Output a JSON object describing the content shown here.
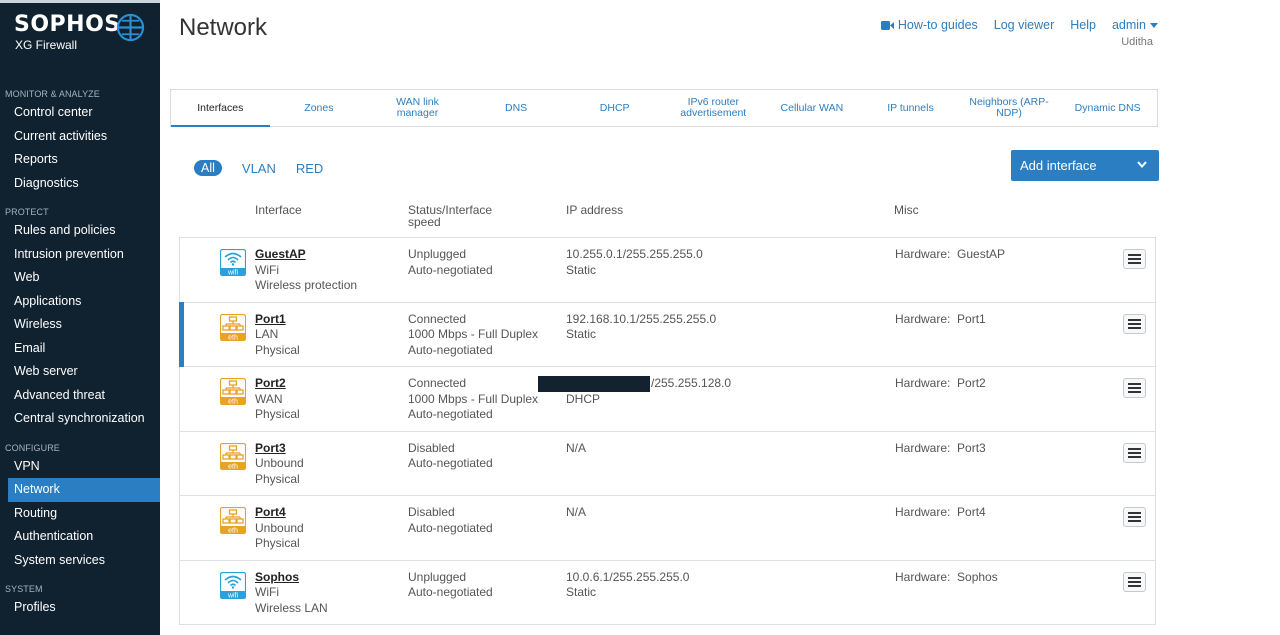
{
  "brand": {
    "name": "SOPHOS",
    "product": "XG Firewall"
  },
  "sidebar": {
    "sections": [
      {
        "title": "MONITOR & ANALYZE",
        "items": [
          "Control center",
          "Current activities",
          "Reports",
          "Diagnostics"
        ]
      },
      {
        "title": "PROTECT",
        "items": [
          "Rules and policies",
          "Intrusion prevention",
          "Web",
          "Applications",
          "Wireless",
          "Email",
          "Web server",
          "Advanced threat",
          "Central synchronization"
        ]
      },
      {
        "title": "CONFIGURE",
        "items": [
          "VPN",
          "Network",
          "Routing",
          "Authentication",
          "System services"
        ]
      },
      {
        "title": "SYSTEM",
        "items": [
          "Profiles"
        ]
      }
    ],
    "active": "Network"
  },
  "header": {
    "title": "Network",
    "links": {
      "guides": "How-to guides",
      "log": "Log viewer",
      "help": "Help",
      "user": "admin"
    },
    "user_sub": "Uditha"
  },
  "tabs": [
    {
      "label": "Interfaces",
      "active": true
    },
    {
      "label": "Zones"
    },
    {
      "label": "WAN link manager"
    },
    {
      "label": "DNS"
    },
    {
      "label": "DHCP"
    },
    {
      "label": "IPv6 router advertisement"
    },
    {
      "label": "Cellular WAN"
    },
    {
      "label": "IP tunnels"
    },
    {
      "label": "Neighbors (ARP-NDP)"
    },
    {
      "label": "Dynamic DNS"
    }
  ],
  "filters": {
    "all": "All",
    "vlan": "VLAN",
    "red": "RED"
  },
  "add_button": "Add interface",
  "columns": {
    "interface": "Interface",
    "status": "Status/Interface speed",
    "ip": "IP address",
    "misc": "Misc"
  },
  "rows": [
    {
      "type": "wifi",
      "badge": "wifi",
      "name": "GuestAP",
      "zone": "WiFi",
      "kind": "Wireless protection",
      "status": [
        "Unplugged",
        "Auto-negotiated"
      ],
      "ip": "10.255.0.1/255.255.255.0",
      "ip_mode": "Static",
      "hw_label": "Hardware:",
      "hw": "GuestAP"
    },
    {
      "type": "eth",
      "badge": "eth",
      "name": "Port1",
      "zone": "LAN",
      "kind": "Physical",
      "status": [
        "Connected",
        "1000 Mbps - Full Duplex",
        "Auto-negotiated"
      ],
      "ip": "192.168.10.1/255.255.255.0",
      "ip_mode": "Static",
      "hw_label": "Hardware:",
      "hw": "Port1",
      "selected": true
    },
    {
      "type": "eth",
      "badge": "eth",
      "name": "Port2",
      "zone": "WAN",
      "kind": "Physical",
      "status": [
        "Connected",
        "1000 Mbps - Full Duplex",
        "Auto-negotiated"
      ],
      "ip": "/255.255.128.0",
      "ip_redacted": true,
      "ip_mode": "DHCP",
      "hw_label": "Hardware:",
      "hw": "Port2"
    },
    {
      "type": "eth",
      "badge": "eth",
      "name": "Port3",
      "zone": "Unbound",
      "kind": "Physical",
      "status": [
        "Disabled",
        "Auto-negotiated"
      ],
      "ip": "N/A",
      "ip_mode": "",
      "hw_label": "Hardware:",
      "hw": "Port3"
    },
    {
      "type": "eth",
      "badge": "eth",
      "name": "Port4",
      "zone": "Unbound",
      "kind": "Physical",
      "status": [
        "Disabled",
        "Auto-negotiated"
      ],
      "ip": "N/A",
      "ip_mode": "",
      "hw_label": "Hardware:",
      "hw": "Port4"
    },
    {
      "type": "wifi",
      "badge": "wifi",
      "name": "Sophos",
      "zone": "WiFi",
      "kind": "Wireless LAN",
      "status": [
        "Unplugged",
        "Auto-negotiated"
      ],
      "ip": "10.0.6.1/255.255.255.0",
      "ip_mode": "Static",
      "hw_label": "Hardware:",
      "hw": "Sophos"
    }
  ],
  "colors": {
    "accent": "#2b7ec1",
    "sidebar": "#10212f",
    "eth": "#e8a227",
    "wifi": "#2aa1d8"
  }
}
